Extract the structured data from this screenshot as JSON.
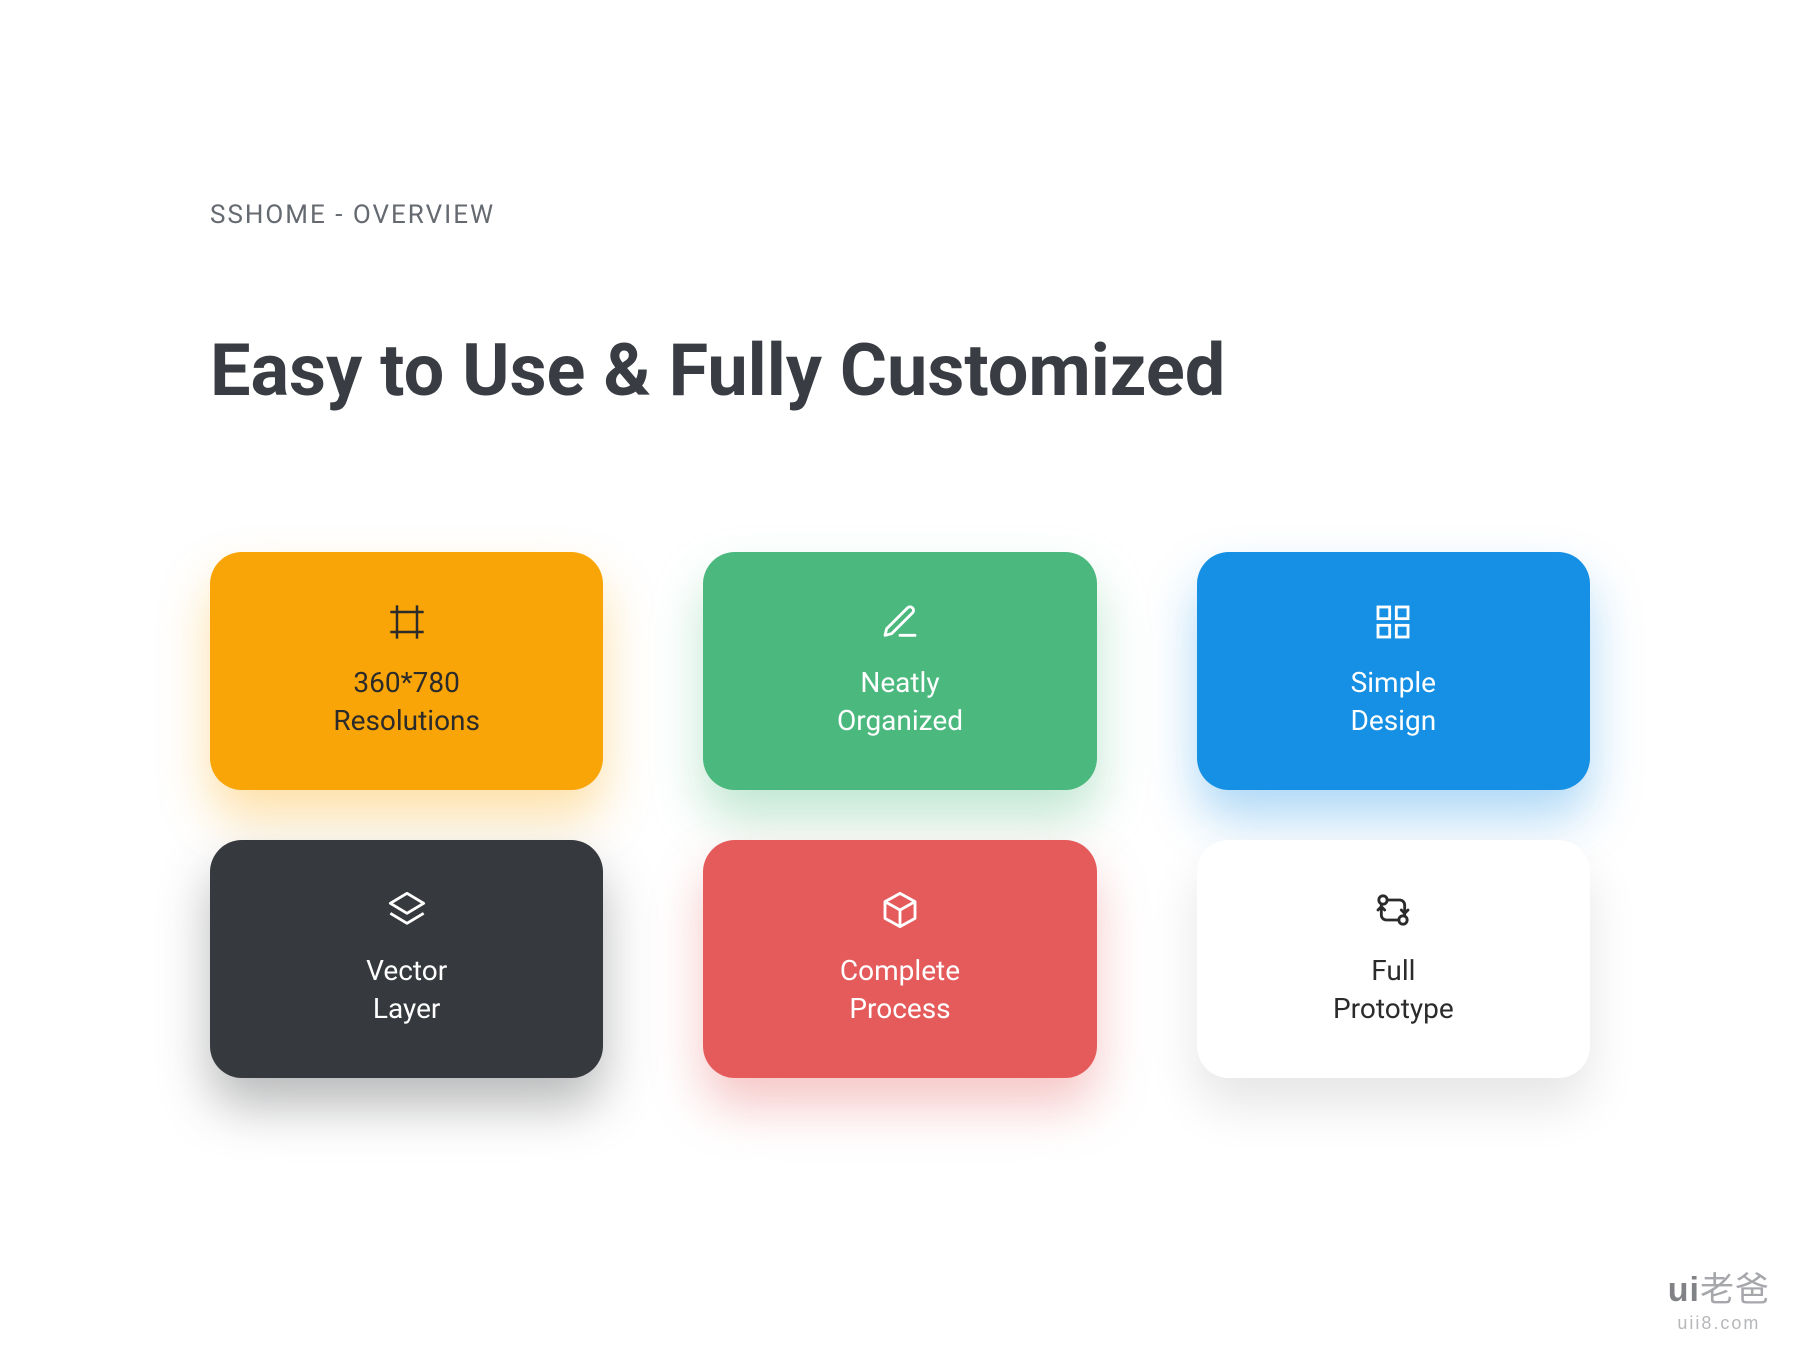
{
  "eyebrow": "SSHOME - OVERVIEW",
  "headline": "Easy to Use\n& Fully Customized",
  "cards": [
    {
      "icon": "frame-icon",
      "label": "360*780\nResolutions",
      "color": "orange"
    },
    {
      "icon": "edit-icon",
      "label": "Neatly\nOrganized",
      "color": "green"
    },
    {
      "icon": "grid-icon",
      "label": "Simple\nDesign",
      "color": "blue"
    },
    {
      "icon": "layers-icon",
      "label": "Vector\nLayer",
      "color": "dark"
    },
    {
      "icon": "cube-icon",
      "label": "Complete\nProcess",
      "color": "red"
    },
    {
      "icon": "compare-icon",
      "label": "Full\nPrototype",
      "color": "white"
    }
  ],
  "watermark": {
    "line1_a": "ui",
    "line1_b": "老爸",
    "line2": "uii8.com"
  }
}
